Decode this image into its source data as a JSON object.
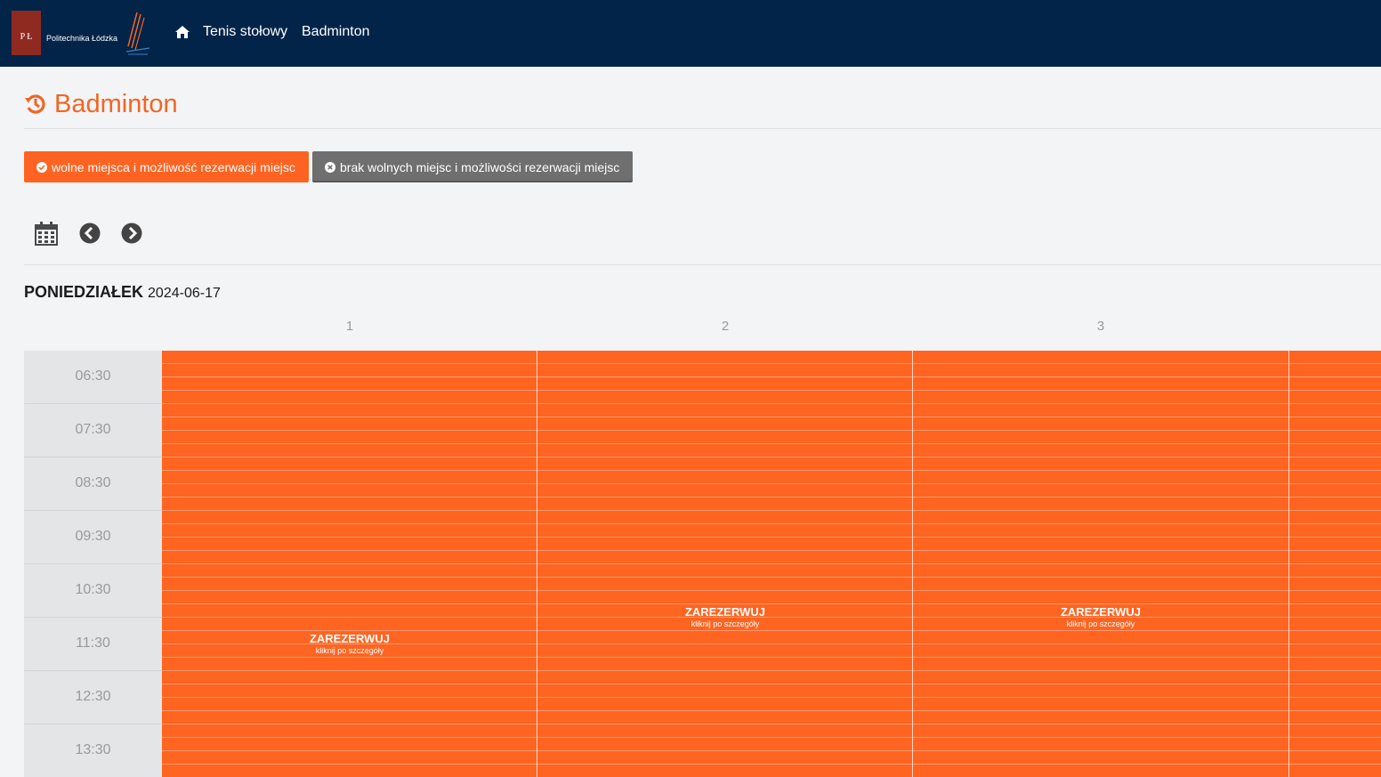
{
  "navbar": {
    "logo_text": "Politechnika Łódzka",
    "logo_initials": "P Ł",
    "links": [
      "Tenis stołowy",
      "Badminton"
    ]
  },
  "page": {
    "title": "Badminton"
  },
  "legend": {
    "free_label": "wolne miejsca i możliwość rezerwacji miejsc",
    "busy_label": "brak wolnych miejsc i możliwości rezerwacji miejsc"
  },
  "schedule": {
    "day_name": "PONIEDZIAŁEK",
    "date": "2024-06-17",
    "courts": [
      "1",
      "2",
      "3"
    ],
    "times": [
      "06:30",
      "07:30",
      "08:30",
      "09:30",
      "10:30",
      "11:30",
      "12:30",
      "13:30"
    ],
    "slot_label": "ZAREZERWUJ",
    "slot_hint": "kliknij po szczegóły"
  },
  "colors": {
    "navbar": "#022449",
    "accent": "#ff6322",
    "busy": "#6f6f6f"
  }
}
